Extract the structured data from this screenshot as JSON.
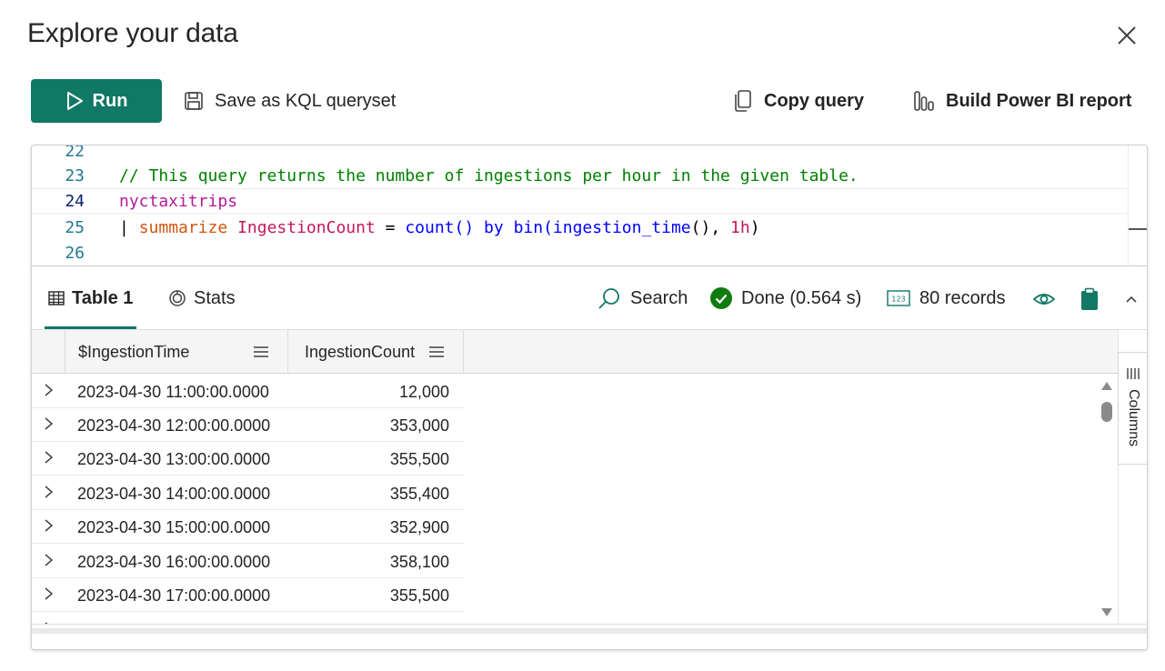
{
  "dialog": {
    "title": "Explore your data"
  },
  "toolbar": {
    "run_label": "Run",
    "save_label": "Save as KQL queryset",
    "copy_label": "Copy query",
    "powerbi_label": "Build Power BI report"
  },
  "editor": {
    "lines": [
      {
        "number": "22"
      },
      {
        "number": "23",
        "comment": "// This query returns the number of ingestions per hour in the given table."
      },
      {
        "number": "24",
        "table": "nyctaxitrips"
      },
      {
        "number": "25",
        "pipe": "|",
        "keyword": "summarize",
        "column": "IngestionCount",
        "eq": "=",
        "count_fn": "count()",
        "by": "by",
        "bin_fn": "bin(",
        "ingestion_fn": "ingestion_time",
        "rest": "(),",
        "num": "1h",
        "close": ")"
      },
      {
        "number": "26"
      }
    ]
  },
  "results": {
    "tabs": [
      {
        "label": "Table 1",
        "active": true
      },
      {
        "label": "Stats",
        "active": false
      }
    ],
    "search_label": "Search",
    "status_label": "Done (0.564 s)",
    "records_label": "80 records",
    "status_color": "#107c10",
    "accent_color": "#117865"
  },
  "grid": {
    "columns": [
      "$IngestionTime",
      "IngestionCount"
    ],
    "rows": [
      {
        "time": "2023-04-30 11:00:00.0000",
        "count": "12,000"
      },
      {
        "time": "2023-04-30 12:00:00.0000",
        "count": "353,000"
      },
      {
        "time": "2023-04-30 13:00:00.0000",
        "count": "355,500"
      },
      {
        "time": "2023-04-30 14:00:00.0000",
        "count": "355,400"
      },
      {
        "time": "2023-04-30 15:00:00.0000",
        "count": "352,900"
      },
      {
        "time": "2023-04-30 16:00:00.0000",
        "count": "358,100"
      },
      {
        "time": "2023-04-30 17:00:00.0000",
        "count": "355,500"
      }
    ],
    "columns_panel_label": "Columns"
  }
}
